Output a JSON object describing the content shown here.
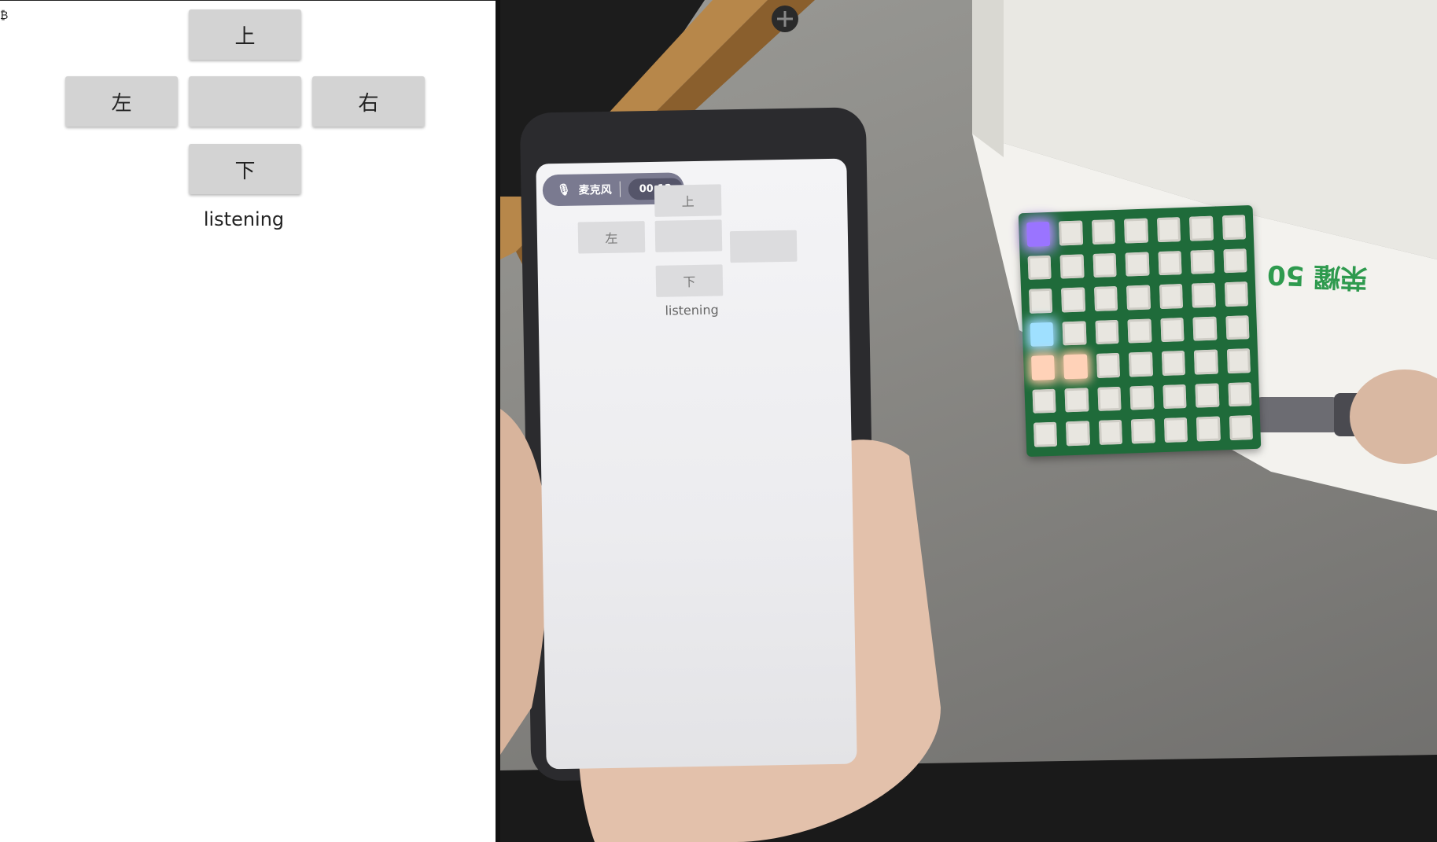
{
  "app": {
    "corner_glyph": "₿",
    "buttons": {
      "up": "上",
      "left": "左",
      "center": "",
      "right": "右",
      "down": "下"
    },
    "status": "listening"
  },
  "photo": {
    "phone_screen": {
      "mic_label": "麦克风",
      "timer": "00:12",
      "buttons": {
        "up": "上",
        "left": "左",
        "down": "下"
      },
      "status": "listening"
    },
    "box_text": "荣耀 50",
    "led_matrix": {
      "rows": 7,
      "cols": 7,
      "lit": [
        {
          "row": 0,
          "col": 0,
          "color": "purple"
        },
        {
          "row": 3,
          "col": 0,
          "color": "cyan"
        },
        {
          "row": 4,
          "col": 0,
          "color": "peach"
        },
        {
          "row": 4,
          "col": 1,
          "color": "peach"
        }
      ]
    }
  },
  "colors": {
    "button_bg": "#d3d3d3",
    "board_green": "#1f6b3a",
    "box_text_green": "#2e9a4e"
  }
}
